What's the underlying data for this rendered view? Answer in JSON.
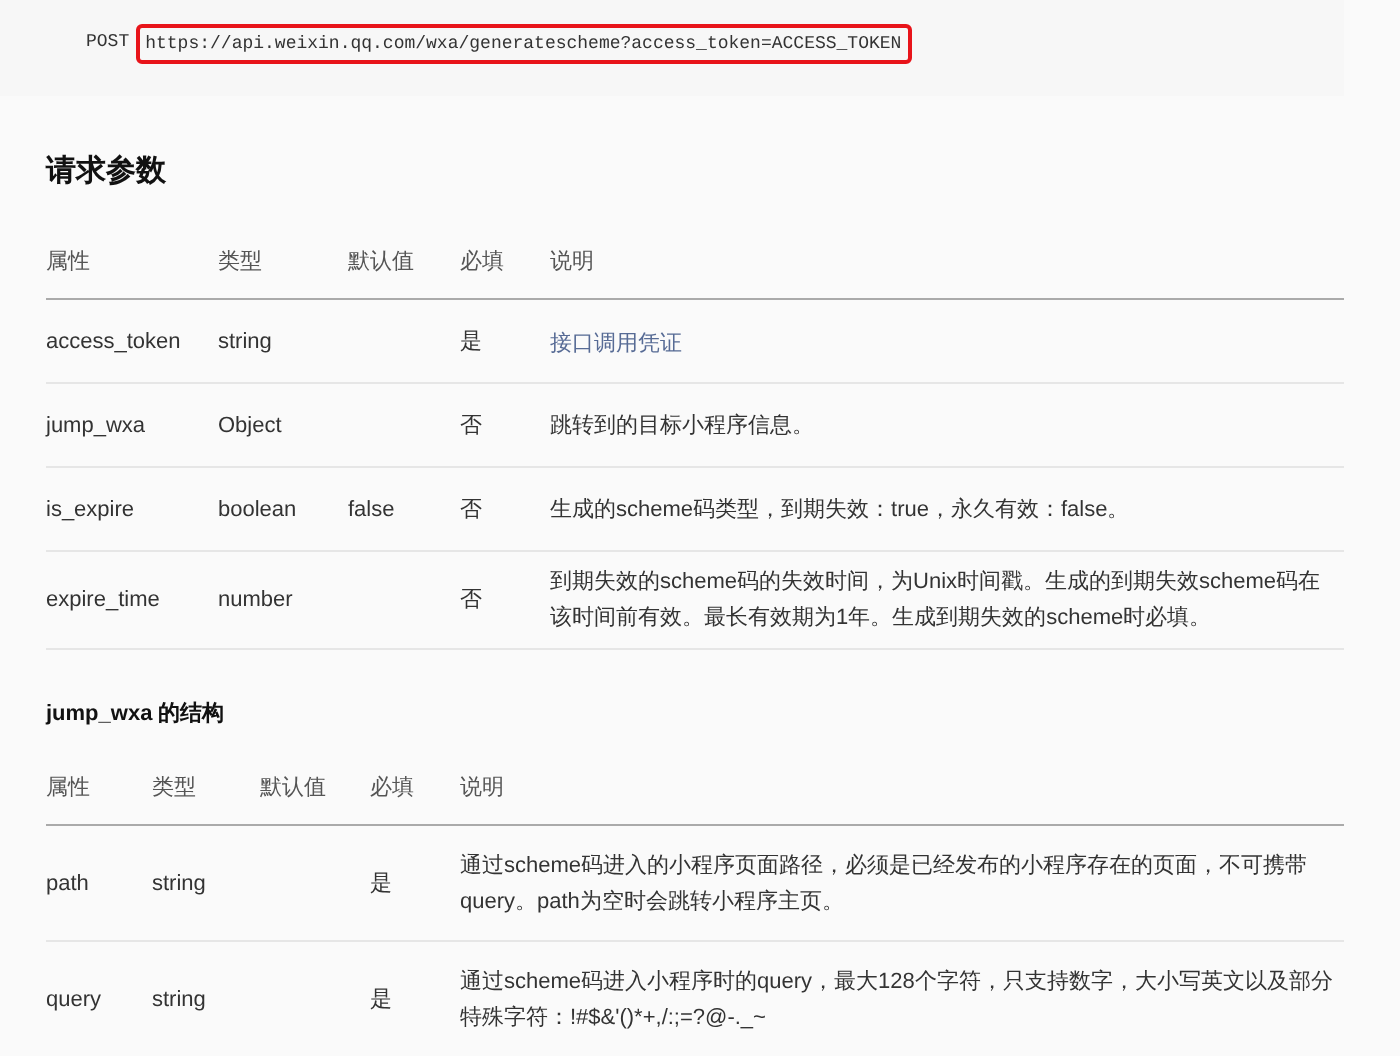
{
  "request": {
    "method": "POST",
    "url": "https://api.weixin.qq.com/wxa/generatescheme?access_token=ACCESS_TOKEN",
    "highlighted": true
  },
  "sections": [
    {
      "title": "请求参数",
      "kind": "main",
      "columns": [
        "属性",
        "类型",
        "默认值",
        "必填",
        "说明"
      ],
      "rows": [
        {
          "cells": [
            "access_token",
            "string",
            "",
            "是",
            "接口调用凭证"
          ],
          "link": true
        },
        {
          "cells": [
            "jump_wxa",
            "Object",
            "",
            "否",
            "跳转到的目标小程序信息。"
          ],
          "link": false
        },
        {
          "cells": [
            "is_expire",
            "boolean",
            "false",
            "否",
            "生成的scheme码类型，到期失效：true，永久有效：false。"
          ],
          "link": false
        },
        {
          "cells": [
            "expire_time",
            "number",
            "",
            "否",
            "到期失效的scheme码的失效时间，为Unix时间戳。生成的到期失效scheme码在该时间前有效。最长有效期为1年。生成到期失效的scheme时必填。"
          ],
          "link": false
        }
      ]
    },
    {
      "title": "jump_wxa 的结构",
      "kind": "sub",
      "columns": [
        "属性",
        "类型",
        "默认值",
        "必填",
        "说明"
      ],
      "rows": [
        {
          "cells": [
            "path",
            "string",
            "",
            "是",
            "通过scheme码进入的小程序页面路径，必须是已经发布的小程序存在的页面，不可携带query。path为空时会跳转小程序主页。"
          ],
          "link": false
        },
        {
          "cells": [
            "query",
            "string",
            "",
            "是",
            "通过scheme码进入小程序时的query，最大128个字符，只支持数字，大小写英文以及部分特殊字符：!#$&'()*+,/:;=?@-._~"
          ],
          "link": false
        }
      ]
    }
  ]
}
